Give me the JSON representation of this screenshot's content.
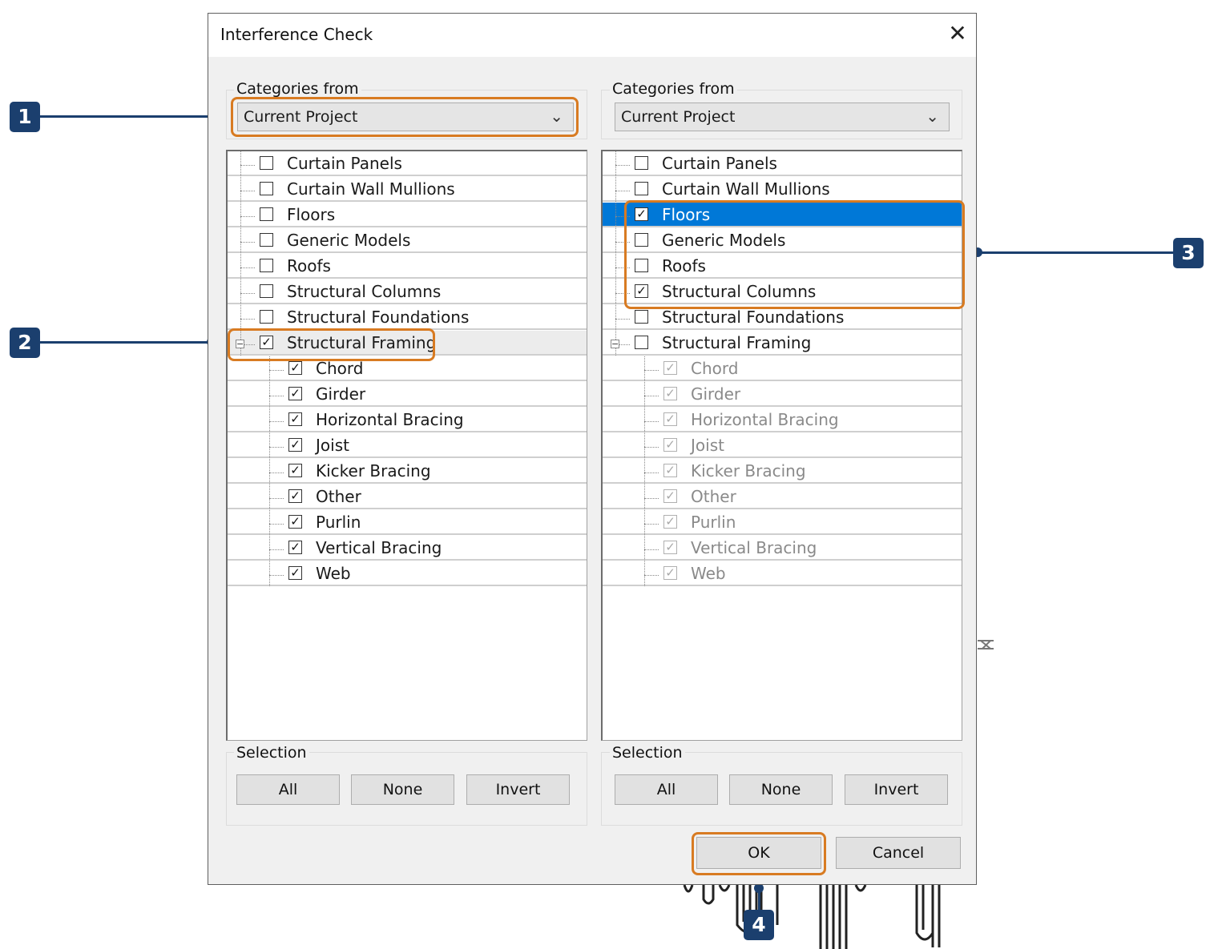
{
  "dialog": {
    "title": "Interference Check",
    "close_label": "✕",
    "ok_label": "OK",
    "cancel_label": "Cancel"
  },
  "left": {
    "categories_label": "Categories from",
    "source_value": "Current Project",
    "selection_label": "Selection",
    "buttons": {
      "all": "All",
      "none": "None",
      "invert": "Invert"
    },
    "items": [
      {
        "label": "Curtain Panels",
        "checked": false,
        "level": 0
      },
      {
        "label": "Curtain Wall Mullions",
        "checked": false,
        "level": 0
      },
      {
        "label": "Floors",
        "checked": false,
        "level": 0
      },
      {
        "label": "Generic Models",
        "checked": false,
        "level": 0
      },
      {
        "label": "Roofs",
        "checked": false,
        "level": 0
      },
      {
        "label": "Structural Columns",
        "checked": false,
        "level": 0
      },
      {
        "label": "Structural Foundations",
        "checked": false,
        "level": 0
      },
      {
        "label": "Structural Framing",
        "checked": true,
        "level": 0,
        "expanded": true,
        "hover": true
      },
      {
        "label": "Chord",
        "checked": true,
        "level": 1
      },
      {
        "label": "Girder",
        "checked": true,
        "level": 1
      },
      {
        "label": "Horizontal Bracing",
        "checked": true,
        "level": 1
      },
      {
        "label": "Joist",
        "checked": true,
        "level": 1
      },
      {
        "label": "Kicker Bracing",
        "checked": true,
        "level": 1
      },
      {
        "label": "Other",
        "checked": true,
        "level": 1
      },
      {
        "label": "Purlin",
        "checked": true,
        "level": 1
      },
      {
        "label": "Vertical Bracing",
        "checked": true,
        "level": 1
      },
      {
        "label": "Web",
        "checked": true,
        "level": 1
      }
    ]
  },
  "right": {
    "categories_label": "Categories from",
    "source_value": "Current Project",
    "selection_label": "Selection",
    "buttons": {
      "all": "All",
      "none": "None",
      "invert": "Invert"
    },
    "items": [
      {
        "label": "Curtain Panels",
        "checked": false,
        "level": 0
      },
      {
        "label": "Curtain Wall Mullions",
        "checked": false,
        "level": 0
      },
      {
        "label": "Floors",
        "checked": true,
        "level": 0,
        "selected": true
      },
      {
        "label": "Generic Models",
        "checked": false,
        "level": 0
      },
      {
        "label": "Roofs",
        "checked": false,
        "level": 0
      },
      {
        "label": "Structural Columns",
        "checked": true,
        "level": 0
      },
      {
        "label": "Structural Foundations",
        "checked": false,
        "level": 0
      },
      {
        "label": "Structural Framing",
        "checked": false,
        "level": 0,
        "expanded": true
      },
      {
        "label": "Chord",
        "checked": true,
        "level": 1,
        "disabled": true
      },
      {
        "label": "Girder",
        "checked": true,
        "level": 1,
        "disabled": true
      },
      {
        "label": "Horizontal Bracing",
        "checked": true,
        "level": 1,
        "disabled": true
      },
      {
        "label": "Joist",
        "checked": true,
        "level": 1,
        "disabled": true
      },
      {
        "label": "Kicker Bracing",
        "checked": true,
        "level": 1,
        "disabled": true
      },
      {
        "label": "Other",
        "checked": true,
        "level": 1,
        "disabled": true
      },
      {
        "label": "Purlin",
        "checked": true,
        "level": 1,
        "disabled": true
      },
      {
        "label": "Vertical Bracing",
        "checked": true,
        "level": 1,
        "disabled": true
      },
      {
        "label": "Web",
        "checked": true,
        "level": 1,
        "disabled": true
      }
    ]
  },
  "callouts": [
    "1",
    "2",
    "3",
    "4"
  ],
  "colors": {
    "highlight": "#d87b22",
    "callout": "#1b3f6e",
    "selection": "#0078d7"
  }
}
